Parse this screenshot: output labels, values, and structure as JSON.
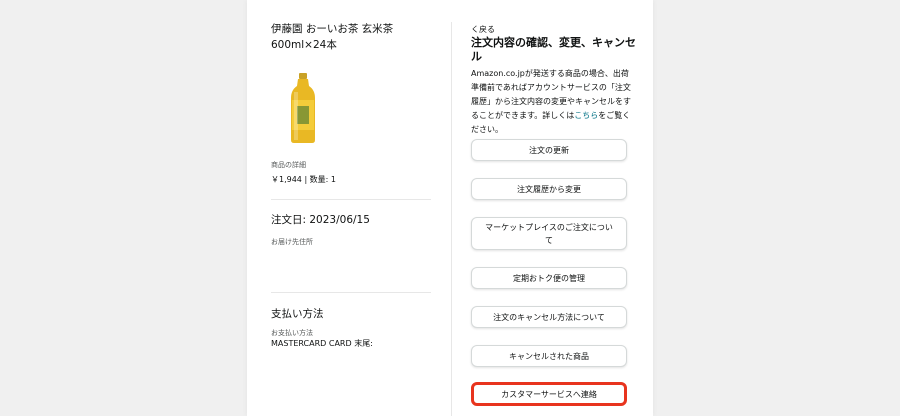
{
  "product": {
    "title": "伊藤園 おーいお茶 玄米茶 600ml×24本",
    "detail_label": "商品の詳細",
    "price_qty": "￥1,944 | 数量: 1"
  },
  "order": {
    "date": "注文日: 2023/06/15",
    "ship_to_label": "お届け先住所"
  },
  "payment": {
    "title": "支払い方法",
    "label": "お支払い方法",
    "value": "MASTERCARD CARD 末尾:"
  },
  "panel": {
    "back": "く戻る",
    "title": "注文内容の確認、変更、キャンセル",
    "desc_before": "Amazon.co.jpが発送する商品の場合、出荷準備前であればアカウントサービスの「注文履歴」から注文内容の変更やキャンセルをすることができます。詳しくは",
    "desc_link": "こちら",
    "desc_after": "をご覧ください。"
  },
  "buttons": [
    "注文の更新",
    "注文履歴から変更",
    "マーケットプレイスのご注文について",
    "定期おトク便の管理",
    "注文のキャンセル方法について",
    "キャンセルされた商品",
    "カスタマーサービスへ連絡"
  ],
  "colors": {
    "highlight_border": "#e8341e",
    "link": "#007185"
  }
}
